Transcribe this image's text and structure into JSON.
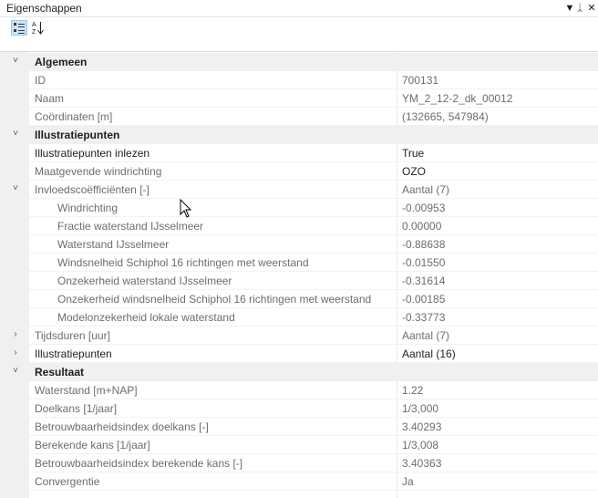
{
  "window": {
    "title": "Eigenschappen",
    "btn_dropdown": "▼",
    "btn_pin": "ᛣ",
    "btn_close": "✕"
  },
  "toolbar": {
    "categorized_icon": "categorized-icon",
    "alphabetical_icon": "sort-az-icon"
  },
  "colors": {
    "category_bg": "#f0f0f0",
    "selected_tool_bg": "#cce4f7",
    "readonly_text": "#6d6d6d"
  },
  "rows": [
    {
      "type": "category",
      "expander": "˅",
      "name": "Algemeen"
    },
    {
      "name": "ID",
      "value": "700131"
    },
    {
      "name": "Naam",
      "value": "YM_2_12-2_dk_00012"
    },
    {
      "name": "Coördinaten [m]",
      "value": "(132665, 547984)"
    },
    {
      "type": "category",
      "expander": "˅",
      "name": "Illustratiepunten"
    },
    {
      "name": "Illustratiepunten inlezen",
      "value": "True",
      "editable": true
    },
    {
      "name": "Maatgevende windrichting",
      "value": "OZO",
      "strongval": true
    },
    {
      "type": "expandable",
      "expander": "˅",
      "name": "Invloedscoëfficiënten [-]",
      "value": "Aantal (7)"
    },
    {
      "name": "Windrichting",
      "value": "-0.00953",
      "indent": true
    },
    {
      "name": "Fractie waterstand IJsselmeer",
      "value": "0.00000",
      "indent": true
    },
    {
      "name": "Waterstand IJsselmeer",
      "value": "-0.88638",
      "indent": true
    },
    {
      "name": "Windsnelheid Schiphol 16 richtingen met weerstand",
      "value": "-0.01550",
      "indent": true
    },
    {
      "name": "Onzekerheid waterstand IJsselmeer",
      "value": "-0.31614",
      "indent": true
    },
    {
      "name": "Onzekerheid windsnelheid Schiphol 16 richtingen met weerstand",
      "value": "-0.00185",
      "indent": true
    },
    {
      "name": "Modelonzekerheid lokale waterstand",
      "value": "-0.33773",
      "indent": true
    },
    {
      "type": "expandable",
      "expander": "›",
      "name": "Tijdsduren [uur]",
      "value": "Aantal (7)"
    },
    {
      "type": "expandable",
      "expander": "›",
      "name": "Illustratiepunten",
      "value": "Aantal (16)",
      "editable": true
    },
    {
      "type": "category",
      "expander": "˅",
      "name": "Resultaat"
    },
    {
      "name": "Waterstand [m+NAP]",
      "value": "1.22"
    },
    {
      "name": "Doelkans [1/jaar]",
      "value": "1/3,000"
    },
    {
      "name": "Betrouwbaarheidsindex doelkans [-]",
      "value": "3.40293"
    },
    {
      "name": "Berekende kans [1/jaar]",
      "value": "1/3,008"
    },
    {
      "name": "Betrouwbaarheidsindex berekende kans [-]",
      "value": "3.40363"
    },
    {
      "name": "Convergentie",
      "value": "Ja"
    }
  ]
}
